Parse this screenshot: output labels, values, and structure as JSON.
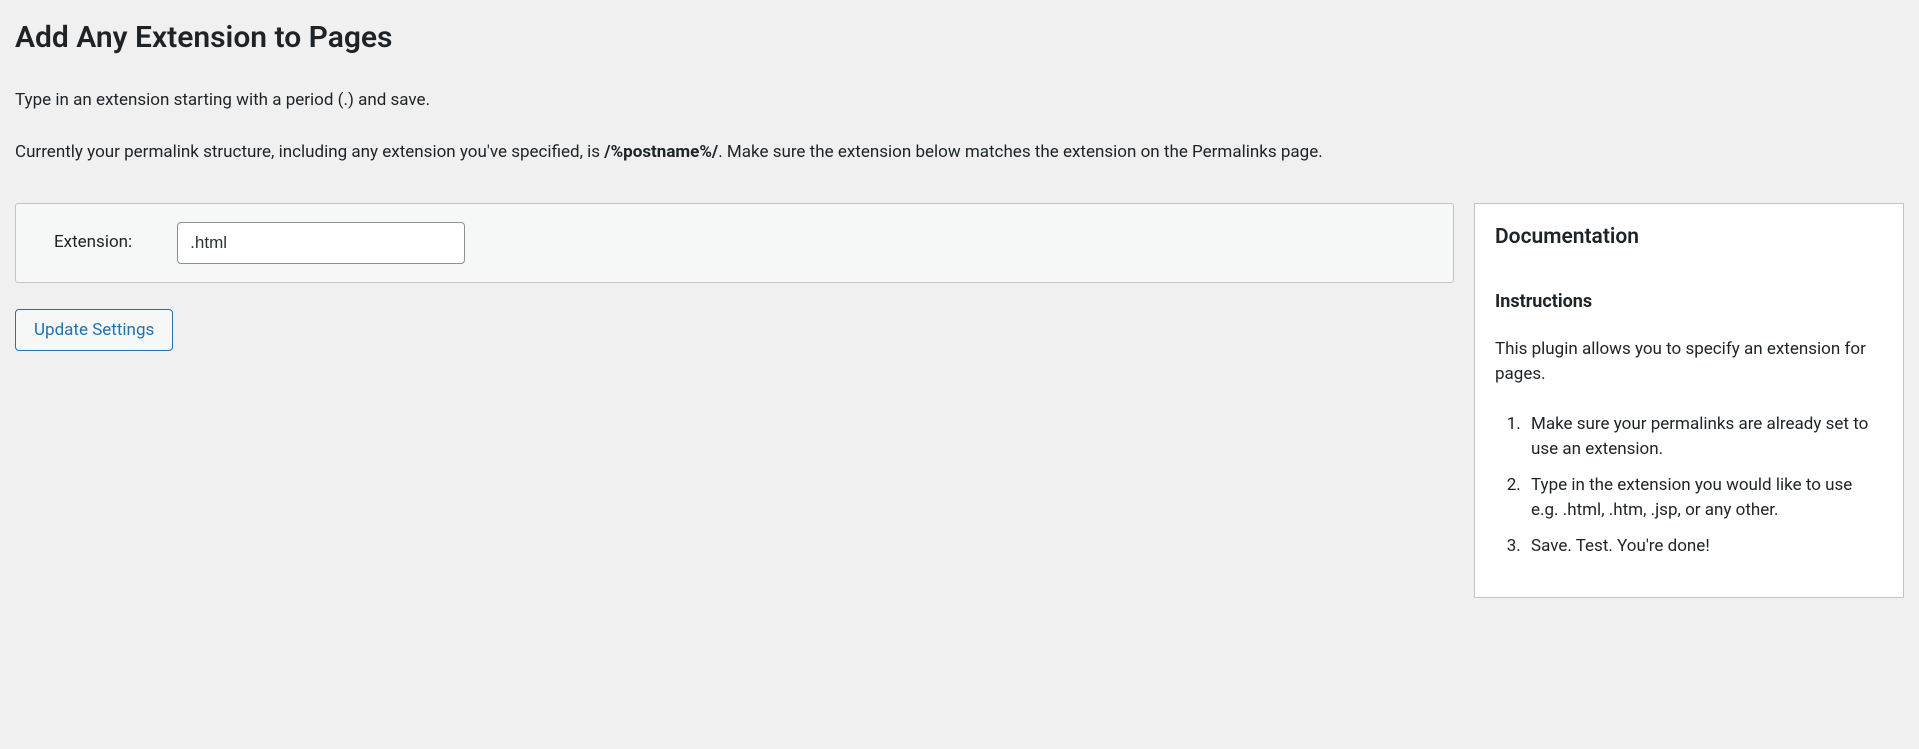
{
  "title": "Add Any Extension to Pages",
  "intro_line": "Type in an extension starting with a period (.) and save.",
  "permalink_line_prefix": "Currently your permalink structure, including any extension you've specified, is ",
  "permalink_current": "/%postname%/",
  "permalink_line_suffix": ". Make sure the extension below matches the extension on the Permalinks page.",
  "form": {
    "field_label": "Extension:",
    "field_value": ".html",
    "submit_label": "Update Settings"
  },
  "doc": {
    "heading": "Documentation",
    "subheading": "Instructions",
    "description": "This plugin allows you to specify an extension for pages.",
    "steps": [
      "Make sure your permalinks are already set to use an extension.",
      "Type in the extension you would like to use e.g. .html, .htm, .jsp, or any other.",
      "Save. Test. You're done!"
    ]
  }
}
